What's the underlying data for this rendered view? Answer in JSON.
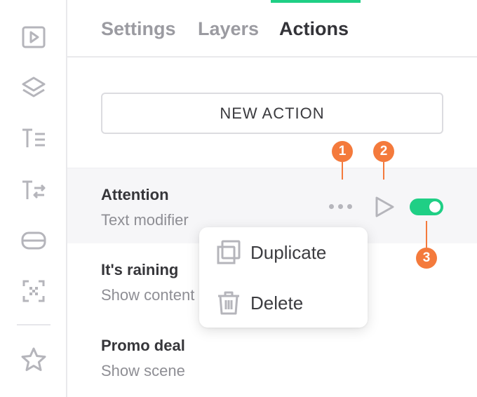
{
  "tabs": [
    {
      "label": "Settings",
      "active": false
    },
    {
      "label": "Layers",
      "active": false
    },
    {
      "label": "Actions",
      "active": true
    }
  ],
  "new_action_label": "NEW ACTION",
  "actions": [
    {
      "title": "Attention",
      "subtitle": "Text modifier",
      "enabled": true
    },
    {
      "title": "It's raining",
      "subtitle": "Show content"
    },
    {
      "title": "Promo deal",
      "subtitle": "Show scene"
    }
  ],
  "context_menu": {
    "items": [
      {
        "label": "Duplicate",
        "icon": "duplicate-icon"
      },
      {
        "label": "Delete",
        "icon": "trash-icon"
      }
    ]
  },
  "callouts": [
    "1",
    "2",
    "3"
  ],
  "sidebar": {
    "icons": [
      "play-box-icon",
      "layers-icon",
      "text-align-icon",
      "text-swap-icon",
      "container-icon",
      "qr-scan-icon",
      "star-icon"
    ]
  },
  "colors": {
    "accent": "#1fcf85",
    "callout": "#f47a3c",
    "muted_text": "#8e8e94",
    "icon_gray": "#b5b5bb"
  }
}
